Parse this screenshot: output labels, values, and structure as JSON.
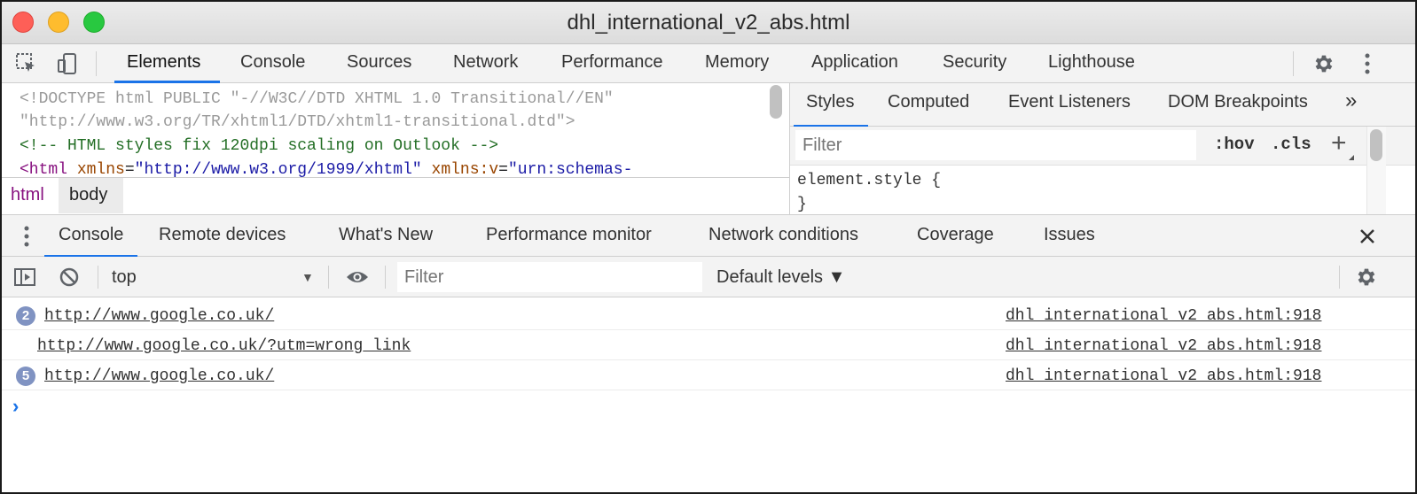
{
  "window": {
    "title": "dhl_international_v2_abs.html"
  },
  "main_tabs": [
    "Elements",
    "Console",
    "Sources",
    "Network",
    "Performance",
    "Memory",
    "Application",
    "Security",
    "Lighthouse"
  ],
  "elements_panel": {
    "line1": "<!DOCTYPE html PUBLIC \"-//W3C//DTD XHTML 1.0 Transitional//EN\"",
    "line2": "\"http://www.w3.org/TR/xhtml1/DTD/xhtml1-transitional.dtd\">",
    "line3": "<!-- HTML styles fix 120dpi scaling on Outlook -->",
    "line4": {
      "open": "<html",
      "attr1": "xmlns",
      "val1": "\"http://www.w3.org/1999/xhtml\"",
      "attr2": "xmlns:v",
      "val2": "\"urn:schemas-"
    },
    "breadcrumbs": [
      "html",
      "body"
    ]
  },
  "styles_panel": {
    "tabs": [
      "Styles",
      "Computed",
      "Event Listeners",
      "DOM Breakpoints"
    ],
    "overflow_label": "»",
    "filter_placeholder": "Filter",
    "hov_label": ":hov",
    "cls_label": ".cls",
    "plus_label": "+",
    "rule_open": "element.style {",
    "rule_close": "}"
  },
  "drawer_tabs": [
    "Console",
    "Remote devices",
    "What's New",
    "Performance monitor",
    "Network conditions",
    "Coverage",
    "Issues"
  ],
  "console_toolbar": {
    "context": "top",
    "filter_placeholder": "Filter",
    "levels": "Default levels ▼"
  },
  "messages": [
    {
      "count": "2",
      "text": "http://www.google.co.uk/",
      "source": "dhl_international_v2_abs.html:918"
    },
    {
      "count": "",
      "text": "http://www.google.co.uk/?utm=wrong_link",
      "source": "dhl_international_v2_abs.html:918"
    },
    {
      "count": "5",
      "text": "http://www.google.co.uk/",
      "source": "dhl_international_v2_abs.html:918"
    }
  ],
  "prompt": "›",
  "icons": [
    "inspect-element-icon",
    "device-toolbar-icon",
    "settings-gear-icon",
    "more-vertical-icon",
    "drawer-menu-icon",
    "close-icon",
    "sidebar-toggle-icon",
    "clear-console-icon",
    "eye-icon",
    "console-settings-icon",
    "dropdown-arrow-icon"
  ],
  "colors": {
    "accent": "#1a73e8",
    "tag": "#881280",
    "attribute": "#994500",
    "value": "#1a1aa6",
    "comment": "#236e25",
    "badge": "#8093c2"
  }
}
